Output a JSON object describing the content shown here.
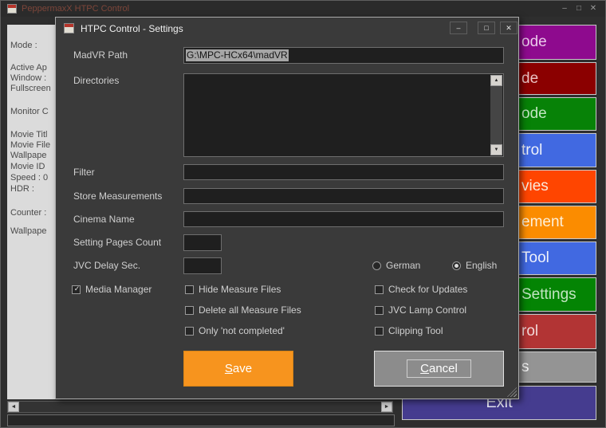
{
  "window": {
    "title": "PeppermaxX HTPC Control",
    "controls": {
      "minimize": "–",
      "maximize": "□",
      "close": "✕"
    }
  },
  "sidebar": {
    "labels": [
      "Mode :",
      "Active Ap",
      "Window :",
      "Fullscreen",
      "Monitor C",
      "Movie Titl",
      "Movie File",
      "Wallpape",
      "Movie ID",
      "Speed : 0",
      "HDR :",
      "Counter :",
      "Wallpape"
    ]
  },
  "right_buttons": [
    {
      "text": "ode",
      "bg": "#8E0A8E",
      "fg": "#EAC9EA"
    },
    {
      "text": "de",
      "bg": "#8B0000",
      "fg": "#EBC3C3"
    },
    {
      "text": "ode",
      "bg": "#078207",
      "fg": "#C2E5C2"
    },
    {
      "text": "trol",
      "bg": "#4169E1",
      "fg": "#EFF2FB"
    },
    {
      "text": "vies",
      "bg": "#FF4500",
      "fg": "#FBE9DC"
    },
    {
      "text": "ement",
      "bg": "#FB8C00",
      "fg": "#FDF0DA"
    },
    {
      "text": "Tool",
      "bg": "#4169E1",
      "fg": "#EFF2FB"
    },
    {
      "text": "Settings",
      "bg": "#048404",
      "fg": "#C2E5C2"
    },
    {
      "text": "rol",
      "bg": "#B23434",
      "fg": "#F2D8D8"
    },
    {
      "text": "s",
      "bg": "#949494",
      "fg": "#F5F5F5"
    }
  ],
  "exit": {
    "label": "Exit",
    "bg": "#453C8F",
    "fg": "#E9E9F6"
  },
  "dialog": {
    "title": "HTPC Control - Settings",
    "controls": {
      "minimize": "–",
      "maximize": "□",
      "close": "✕"
    },
    "fields": {
      "madvr_path": {
        "label": "MadVR Path",
        "value": "G:\\MPC-HCx64\\madVR"
      },
      "directories": {
        "label": "Directories",
        "value": ""
      },
      "filter": {
        "label": "Filter",
        "value": ""
      },
      "store_measurements": {
        "label": "Store Measurements",
        "value": ""
      },
      "cinema_name": {
        "label": "Cinema Name",
        "value": ""
      },
      "setting_pages_count": {
        "label": "Setting Pages Count",
        "value": ""
      },
      "jvc_delay_sec": {
        "label": "JVC Delay Sec.",
        "value": ""
      }
    },
    "language": [
      {
        "label": "German",
        "selected": false
      },
      {
        "label": "English",
        "selected": true
      }
    ],
    "checkboxes": [
      {
        "label": "Media Manager",
        "checked": true
      },
      {
        "label": "Hide Measure Files",
        "checked": false
      },
      {
        "label": "Delete all Measure Files",
        "checked": false
      },
      {
        "label": "Only 'not completed'",
        "checked": false
      },
      {
        "label": "Check for Updates",
        "checked": false
      },
      {
        "label": "JVC Lamp Control",
        "checked": false
      },
      {
        "label": "Clipping Tool",
        "checked": false
      }
    ],
    "buttons": {
      "save": "Save",
      "cancel": "Cancel"
    },
    "colors": {
      "save_bg": "#F7941E",
      "cancel_bg": "#8C8C8C"
    },
    "scroll_icons": {
      "up": "▲",
      "down": "▼"
    }
  },
  "bottom": {
    "scroll_left": "◄",
    "scroll_right": "►"
  }
}
